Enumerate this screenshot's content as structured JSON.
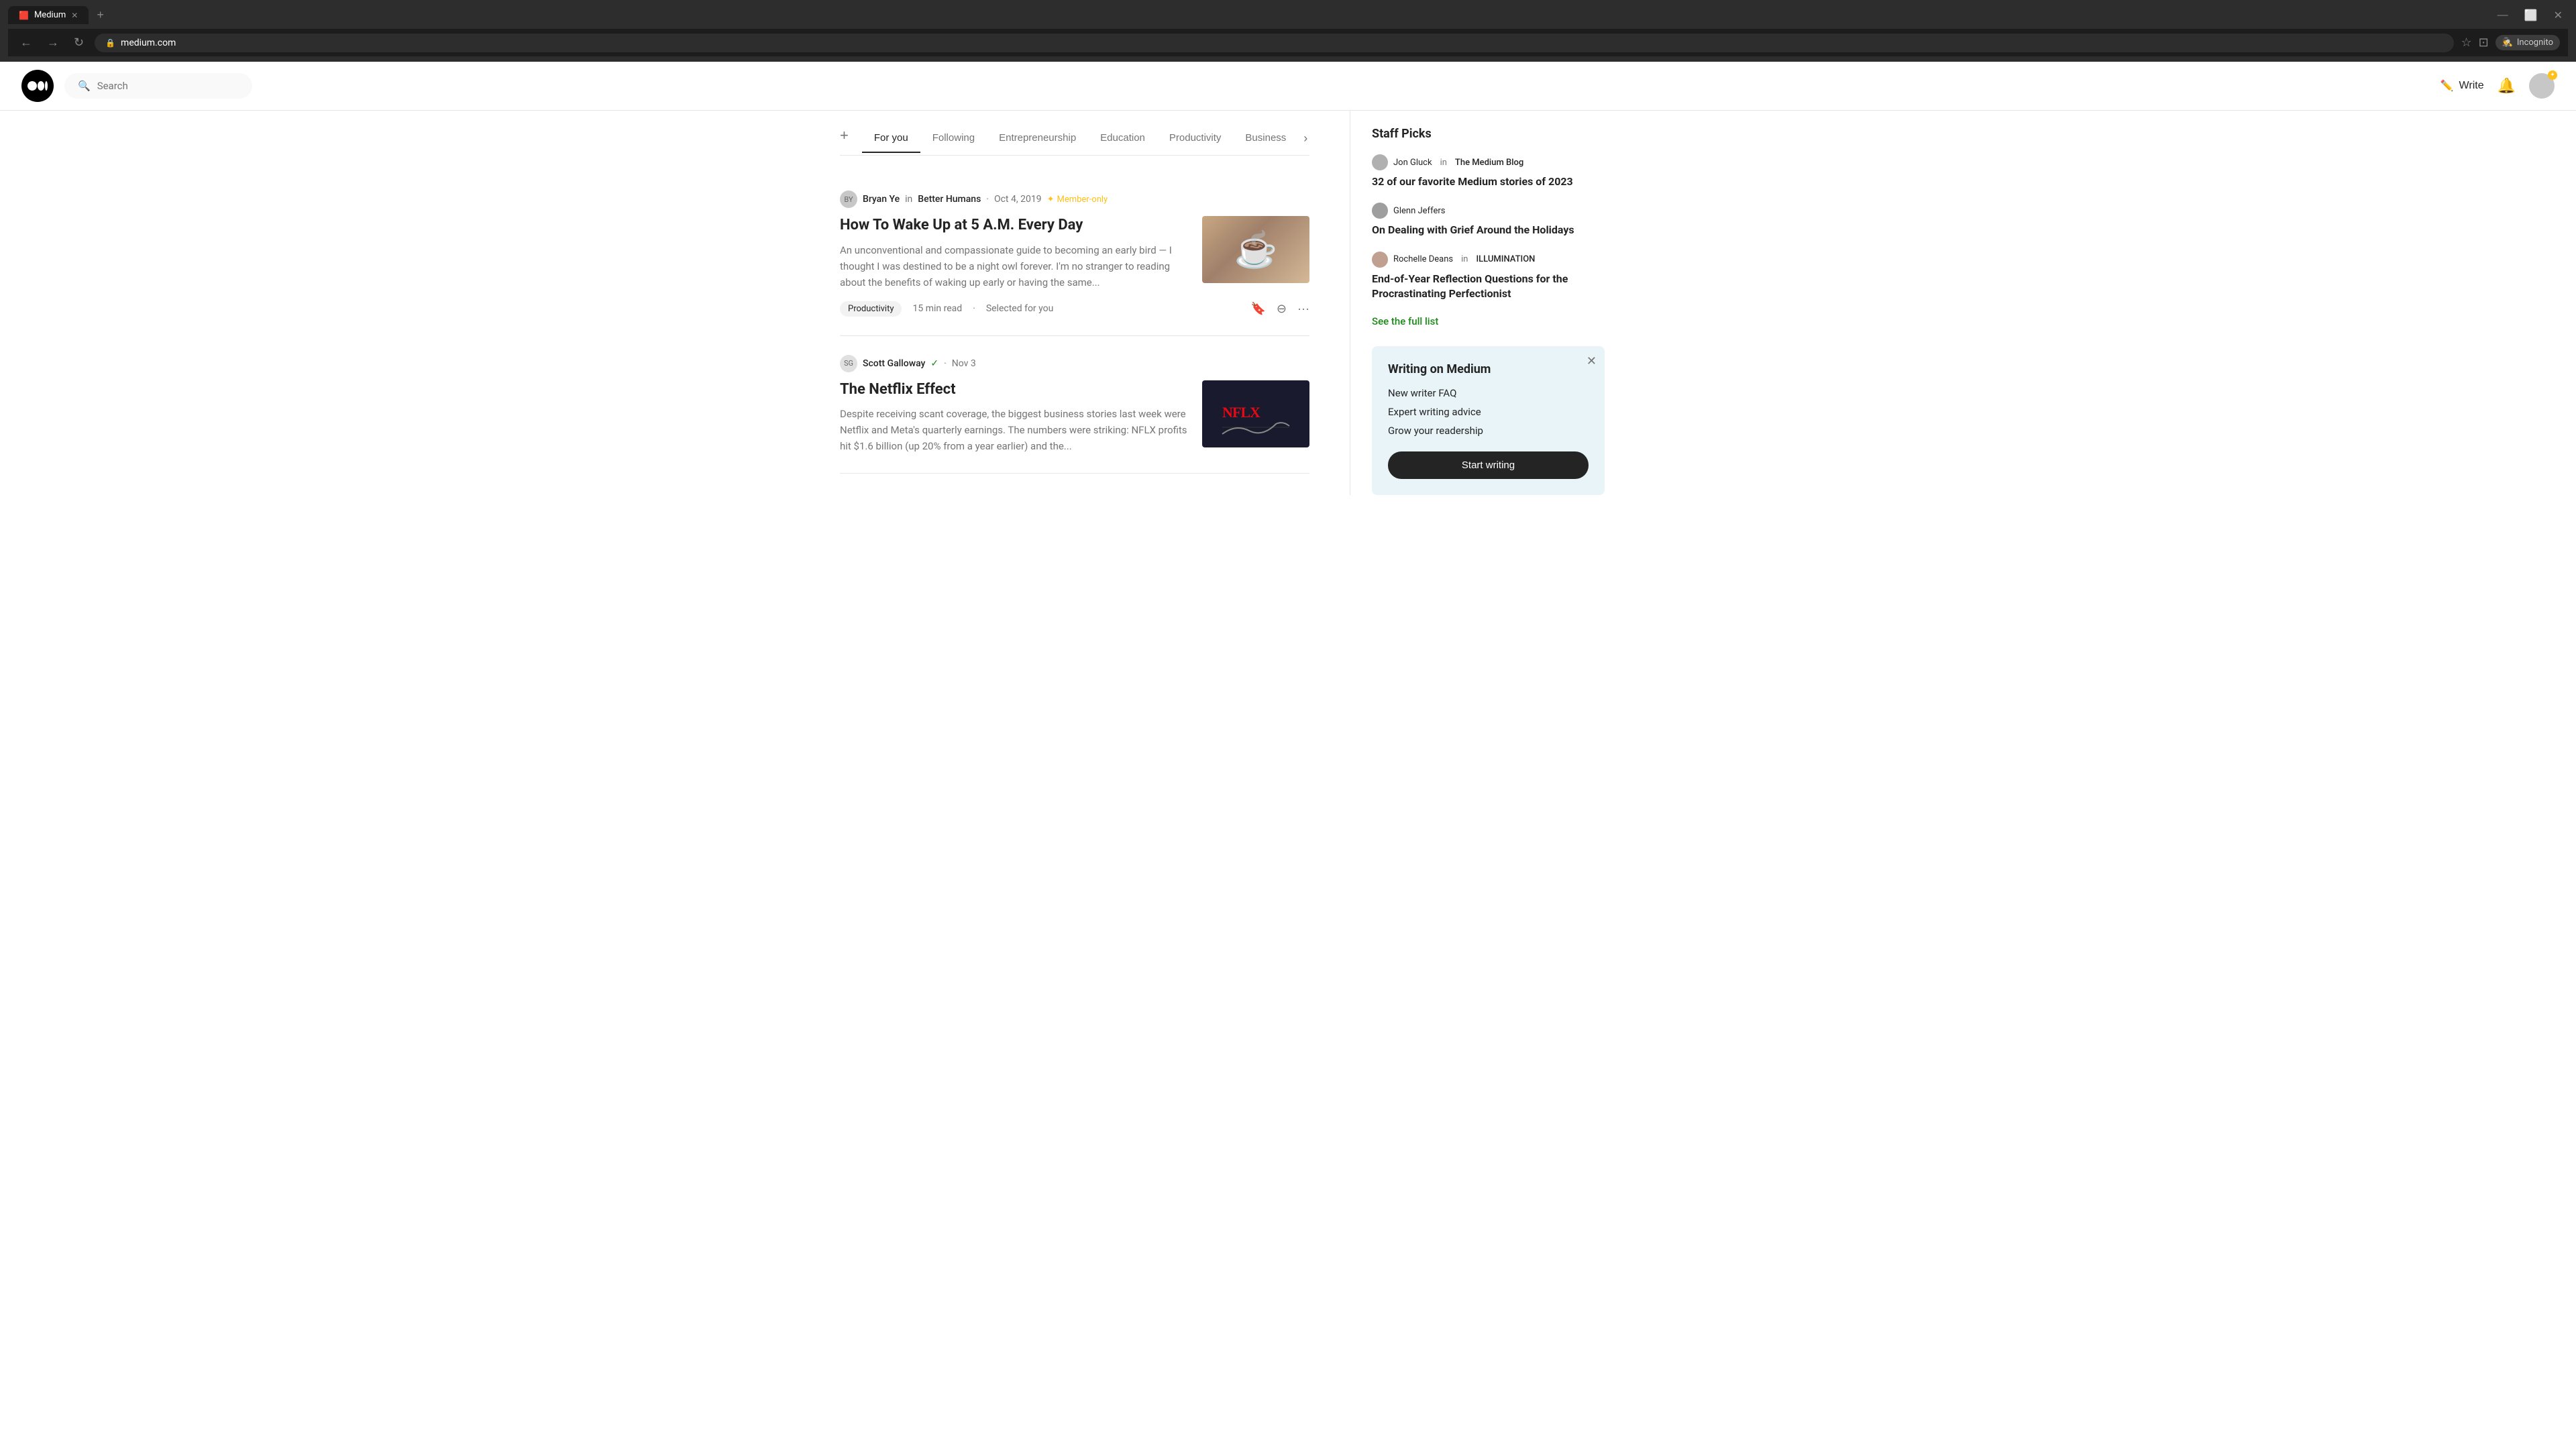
{
  "browser": {
    "tabs": [
      {
        "label": "Medium",
        "active": true,
        "icon": "🟥🟥"
      }
    ],
    "add_tab_label": "+",
    "address": "medium.com",
    "incognito_label": "Incognito",
    "back_icon": "←",
    "forward_icon": "→",
    "refresh_icon": "↻",
    "star_icon": "☆",
    "extensions_icon": "⊡"
  },
  "header": {
    "logo_alt": "Medium",
    "search_placeholder": "Search",
    "write_label": "Write",
    "notification_icon": "🔔",
    "avatar_badge": "✦"
  },
  "tabs": {
    "add_label": "+",
    "items": [
      {
        "label": "For you",
        "active": true
      },
      {
        "label": "Following",
        "active": false
      },
      {
        "label": "Entrepreneurship",
        "active": false
      },
      {
        "label": "Education",
        "active": false
      },
      {
        "label": "Productivity",
        "active": false
      },
      {
        "label": "Business",
        "active": false
      }
    ],
    "scroll_right_icon": "›"
  },
  "articles": [
    {
      "author_name": "Bryan Ye",
      "author_in": "in",
      "pub_name": "Better Humans",
      "date": "Oct 4, 2019",
      "member_only": "Member-only",
      "title": "How To Wake Up at 5 A.M. Every Day",
      "excerpt": "An unconventional and compassionate guide to becoming an early bird — I thought I was destined to be a night owl forever. I'm no stranger to reading about the benefits of waking up early or having the same...",
      "tag": "Productivity",
      "read_time": "15 min read",
      "selected_label": "Selected for you",
      "thumb_type": "coffee"
    },
    {
      "author_name": "Scott Galloway",
      "author_verified": true,
      "date": "Nov 3",
      "title": "The Netflix Effect",
      "excerpt": "Despite receiving scant coverage, the biggest business stories last week were Netflix and Meta's quarterly earnings. The numbers were striking: NFLX profits hit $1.6 billion (up 20% from a year earlier) and the...",
      "tag": "",
      "read_time": "",
      "selected_label": "",
      "thumb_type": "netflix"
    }
  ],
  "sidebar": {
    "staff_picks_title": "Staff Picks",
    "picks": [
      {
        "author_name": "Jon Gluck",
        "author_in": "in",
        "pub_name": "The Medium Blog",
        "title": "32 of our favorite Medium stories of 2023"
      },
      {
        "author_name": "Glenn Jeffers",
        "author_in": "",
        "pub_name": "",
        "title": "On Dealing with Grief Around the Holidays"
      },
      {
        "author_name": "Rochelle Deans",
        "author_in": "in",
        "pub_name": "ILLUMINATION",
        "title": "End-of-Year Reflection Questions for the Procrastinating Perfectionist"
      }
    ],
    "see_full_list_label": "See the full list",
    "writing_card": {
      "title": "Writing on Medium",
      "links": [
        "New writer FAQ",
        "Expert writing advice",
        "Grow your readership"
      ],
      "start_writing_label": "Start writing"
    }
  }
}
